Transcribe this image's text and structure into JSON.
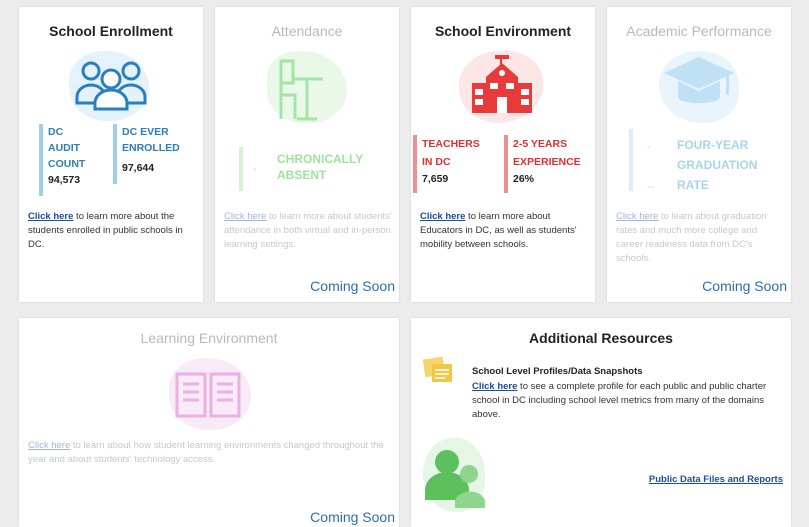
{
  "enrollment": {
    "title": "School Enrollment",
    "stat1_label": "DC\nAUDIT\nCOUNT",
    "stat1_value": "94,573",
    "stat2_label": "DC EVER\nENROLLED",
    "stat2_value": "97,644",
    "link": "Click here",
    "desc": " to learn more about the students enrolled in public schools in DC."
  },
  "attendance": {
    "title": "Attendance",
    "stat_dash": "-",
    "stat_label": "CHRONICALLY\nABSENT",
    "link": "Click here",
    "desc": " to learn more about students' attendance in both virtual and in-person learning settings.",
    "coming": "Coming Soon"
  },
  "environment": {
    "title": "School Environment",
    "stat1_label": "TEACHERS\nIN DC",
    "stat1_value": "7,659",
    "stat2_label": "2-5 YEARS\nEXPERIENCE",
    "stat2_value": "26%",
    "link": "Click here",
    "desc": " to learn more about Educators in DC, as well as students' mobility between schools."
  },
  "academic": {
    "title": "Academic Performance",
    "dash1": "-",
    "dash2": "--",
    "stat_label": "FOUR-YEAR\nGRADUATION\nRATE",
    "link": "Click here",
    "desc": " to learn about graduation rates and much more college and career readiness data from DC's schools.",
    "coming": "Coming Soon"
  },
  "learning": {
    "title": "Learning Environment",
    "link": "Click here",
    "desc": " to learn about how student learning environments changed throughout the year and about students' technology access.",
    "coming": "Coming Soon"
  },
  "resources": {
    "title": "Additional Resources",
    "profile_title": "School Level Profiles/Data Snapshots",
    "profile_link": "Click here",
    "profile_desc": " to see a complete profile for each public and public charter school in DC including school level metrics from many of the domains above.",
    "public_data_link": "Public Data Files and Reports"
  },
  "colors": {
    "link": "#1a4fa0",
    "coming_soon": "#2e6db4",
    "enrollment_accent": "#2a7ec2",
    "environment_accent": "#e03030",
    "attendance_accent": "#8fdc8f",
    "academic_accent": "#a9d4f0",
    "learning_accent": "#e8a8e0",
    "resources_accent": "#4caf50"
  },
  "icons": {
    "enrollment": "people-group-icon",
    "attendance": "student-desk-icon",
    "environment": "school-building-icon",
    "academic": "graduation-cap-icon",
    "learning": "open-book-icon",
    "profiles": "sticky-notes-icon",
    "public_data": "users-icon"
  }
}
